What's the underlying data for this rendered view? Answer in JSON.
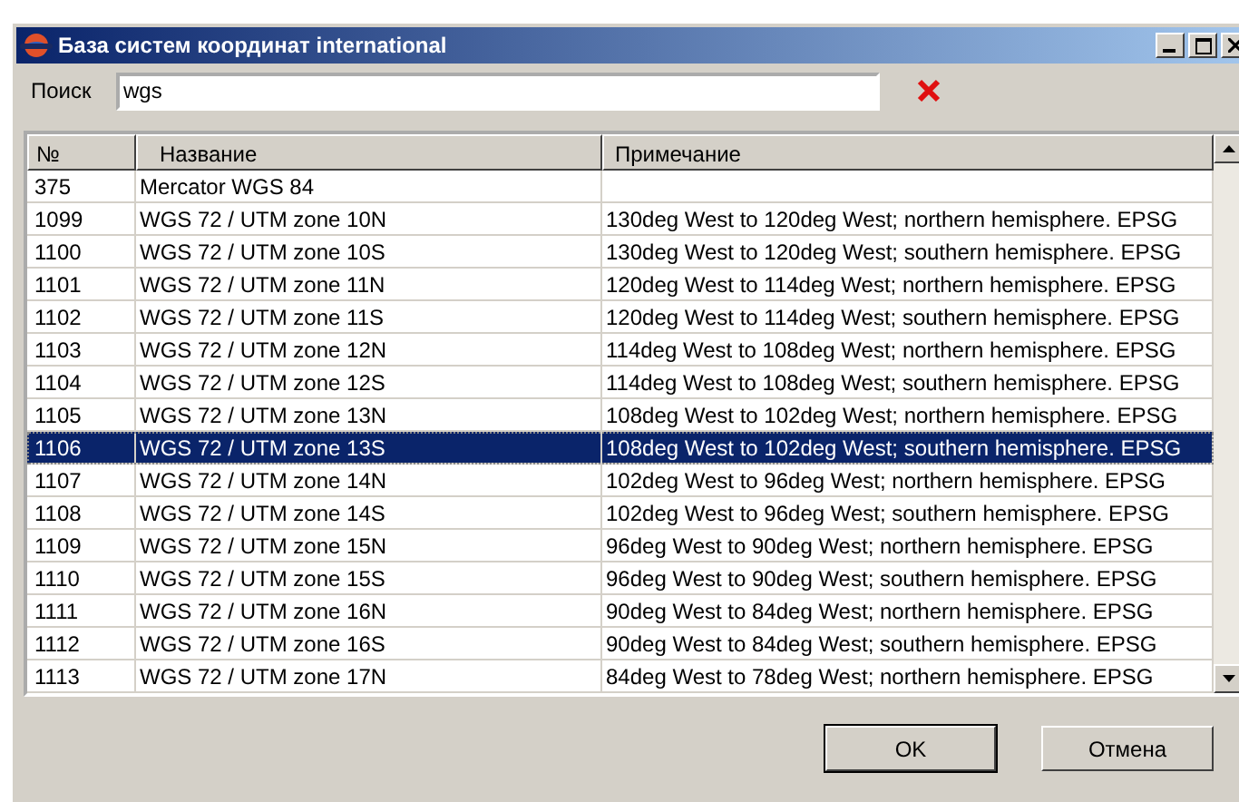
{
  "window": {
    "title": "База систем координат international"
  },
  "search": {
    "label": "Поиск",
    "value": "wgs"
  },
  "table": {
    "columns": [
      "№",
      "Название",
      "Примечание"
    ],
    "rows": [
      {
        "cells": [
          "375",
          "Mercator WGS 84",
          ""
        ],
        "selected": false
      },
      {
        "cells": [
          "1099",
          "WGS 72 / UTM zone 10N",
          "130deg West to 120deg West; northern hemisphere. EPSG"
        ],
        "selected": false
      },
      {
        "cells": [
          "1100",
          "WGS 72 / UTM zone 10S",
          "130deg West to 120deg West; southern hemisphere. EPSG"
        ],
        "selected": false
      },
      {
        "cells": [
          "1101",
          "WGS 72 / UTM zone 11N",
          "120deg West to 114deg West; northern hemisphere. EPSG"
        ],
        "selected": false
      },
      {
        "cells": [
          "1102",
          "WGS 72 / UTM zone 11S",
          "120deg West to 114deg West; southern hemisphere. EPSG"
        ],
        "selected": false
      },
      {
        "cells": [
          "1103",
          "WGS 72 / UTM zone 12N",
          "114deg West to 108deg West; northern hemisphere. EPSG"
        ],
        "selected": false
      },
      {
        "cells": [
          "1104",
          "WGS 72 / UTM zone 12S",
          "114deg West to 108deg West; southern hemisphere. EPSG"
        ],
        "selected": false
      },
      {
        "cells": [
          "1105",
          "WGS 72 / UTM zone 13N",
          "108deg West to 102deg West; northern hemisphere. EPSG"
        ],
        "selected": false
      },
      {
        "cells": [
          "1106",
          "WGS 72 / UTM zone 13S",
          "108deg West to 102deg West; southern hemisphere. EPSG"
        ],
        "selected": true
      },
      {
        "cells": [
          "1107",
          "WGS 72 / UTM zone 14N",
          "102deg West to 96deg West; northern hemisphere. EPSG"
        ],
        "selected": false
      },
      {
        "cells": [
          "1108",
          "WGS 72 / UTM zone 14S",
          "102deg West to 96deg West; southern hemisphere. EPSG"
        ],
        "selected": false
      },
      {
        "cells": [
          "1109",
          "WGS 72 / UTM zone 15N",
          "96deg West to 90deg West; northern hemisphere. EPSG"
        ],
        "selected": false
      },
      {
        "cells": [
          "1110",
          "WGS 72 / UTM zone 15S",
          "96deg West to 90deg West; southern hemisphere. EPSG"
        ],
        "selected": false
      },
      {
        "cells": [
          "1111",
          "WGS 72 / UTM zone 16N",
          "90deg West to 84deg West; northern hemisphere. EPSG"
        ],
        "selected": false
      },
      {
        "cells": [
          "1112",
          "WGS 72 / UTM zone 16S",
          "90deg West to 84deg West; southern hemisphere. EPSG"
        ],
        "selected": false
      },
      {
        "cells": [
          "1113",
          "WGS 72 / UTM zone 17N",
          "84deg West to 78deg West; northern hemisphere. EPSG"
        ],
        "selected": false
      }
    ]
  },
  "buttons": [
    "OK",
    "Отмена"
  ]
}
